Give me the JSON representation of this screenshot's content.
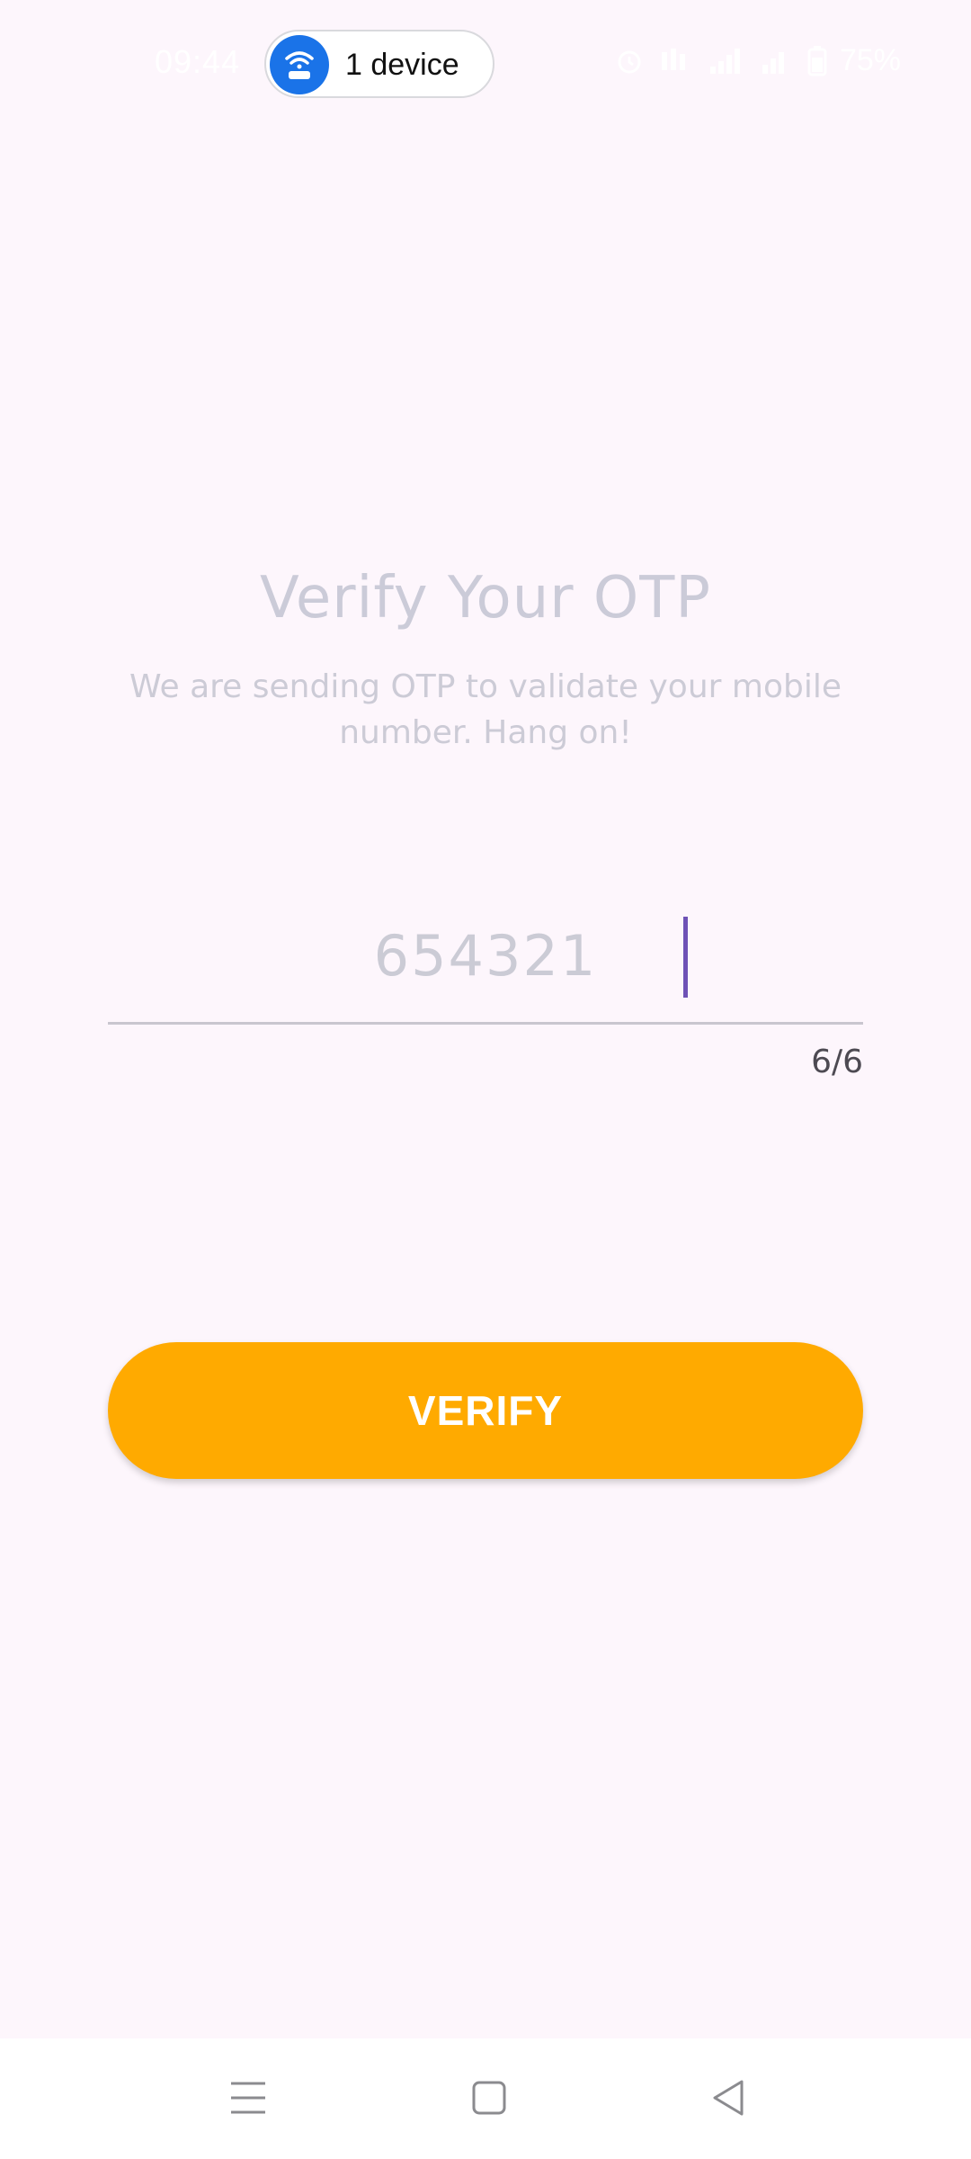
{
  "status_bar": {
    "time": "09:44",
    "hotspot_label": "1 device",
    "battery": "75%"
  },
  "verify_screen": {
    "title": "Verify Your OTP",
    "subtitle": "We are sending OTP to validate your mobile number. Hang on!",
    "otp_value": "654321",
    "otp_counter": "6/6",
    "verify_label": "VERIFY"
  },
  "nav_bar": {
    "recents_icon": "menu-lines-icon",
    "home_icon": "square-icon",
    "back_icon": "triangle-back-icon"
  },
  "colors": {
    "background": "#fdf6fc",
    "accent_button": "#ffaa00",
    "cursor": "#6e52b6",
    "hotspot_blue": "#1a73e8"
  }
}
